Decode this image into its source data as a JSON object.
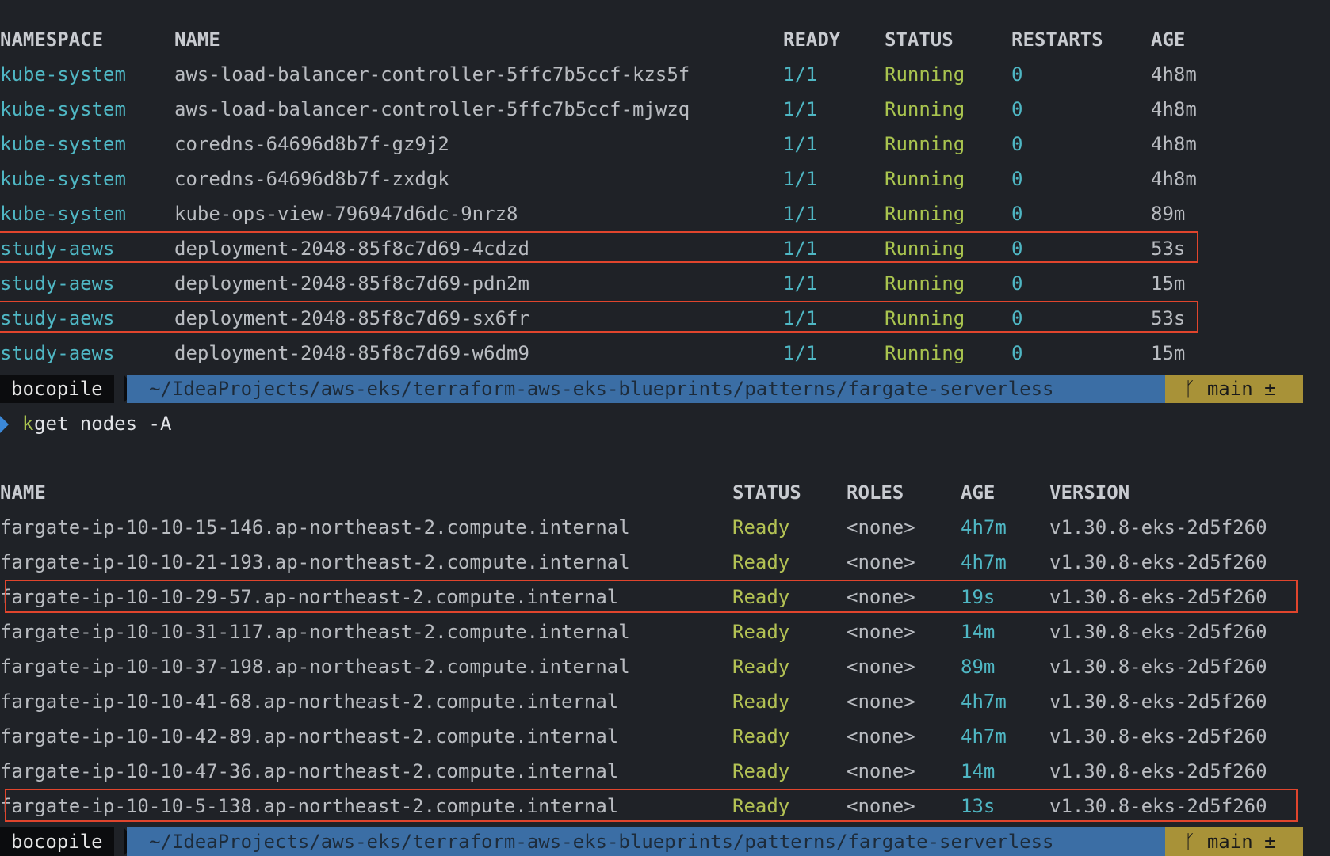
{
  "pods": {
    "headers": {
      "namespace": "NAMESPACE",
      "name": "NAME",
      "ready": "READY",
      "status": "STATUS",
      "restarts": "RESTARTS",
      "age": "AGE"
    },
    "rows": [
      {
        "namespace": "kube-system",
        "name": "aws-load-balancer-controller-5ffc7b5ccf-kzs5f",
        "ready": "1/1",
        "status": "Running",
        "restarts": "0",
        "age": "4h8m",
        "highlighted": false
      },
      {
        "namespace": "kube-system",
        "name": "aws-load-balancer-controller-5ffc7b5ccf-mjwzq",
        "ready": "1/1",
        "status": "Running",
        "restarts": "0",
        "age": "4h8m",
        "highlighted": false
      },
      {
        "namespace": "kube-system",
        "name": "coredns-64696d8b7f-gz9j2",
        "ready": "1/1",
        "status": "Running",
        "restarts": "0",
        "age": "4h8m",
        "highlighted": false
      },
      {
        "namespace": "kube-system",
        "name": "coredns-64696d8b7f-zxdgk",
        "ready": "1/1",
        "status": "Running",
        "restarts": "0",
        "age": "4h8m",
        "highlighted": false
      },
      {
        "namespace": "kube-system",
        "name": "kube-ops-view-796947d6dc-9nrz8",
        "ready": "1/1",
        "status": "Running",
        "restarts": "0",
        "age": "89m",
        "highlighted": false
      },
      {
        "namespace": "study-aews",
        "name": "deployment-2048-85f8c7d69-4cdzd",
        "ready": "1/1",
        "status": "Running",
        "restarts": "0",
        "age": "53s",
        "highlighted": true
      },
      {
        "namespace": "study-aews",
        "name": "deployment-2048-85f8c7d69-pdn2m",
        "ready": "1/1",
        "status": "Running",
        "restarts": "0",
        "age": "15m",
        "highlighted": false
      },
      {
        "namespace": "study-aews",
        "name": "deployment-2048-85f8c7d69-sx6fr",
        "ready": "1/1",
        "status": "Running",
        "restarts": "0",
        "age": "53s",
        "highlighted": true
      },
      {
        "namespace": "study-aews",
        "name": "deployment-2048-85f8c7d69-w6dm9",
        "ready": "1/1",
        "status": "Running",
        "restarts": "0",
        "age": "15m",
        "highlighted": false
      }
    ]
  },
  "prompt": {
    "user": "bocopile",
    "path": "~/IdeaProjects/aws-eks/terraform-aws-eks-blueprints/patterns/fargate-serverless",
    "branch_icon": "git-branch-icon",
    "branch": "main ±"
  },
  "command": {
    "alias": "k",
    "args": " get nodes -A"
  },
  "nodes": {
    "headers": {
      "name": "NAME",
      "status": "STATUS",
      "roles": "ROLES",
      "age": "AGE",
      "version": "VERSION"
    },
    "rows": [
      {
        "name": "fargate-ip-10-10-15-146.ap-northeast-2.compute.internal",
        "status": "Ready",
        "roles": "<none>",
        "age": "4h7m",
        "version": "v1.30.8-eks-2d5f260",
        "highlighted": false
      },
      {
        "name": "fargate-ip-10-10-21-193.ap-northeast-2.compute.internal",
        "status": "Ready",
        "roles": "<none>",
        "age": "4h7m",
        "version": "v1.30.8-eks-2d5f260",
        "highlighted": false
      },
      {
        "name": "fargate-ip-10-10-29-57.ap-northeast-2.compute.internal",
        "status": "Ready",
        "roles": "<none>",
        "age": "19s",
        "version": "v1.30.8-eks-2d5f260",
        "highlighted": true
      },
      {
        "name": "fargate-ip-10-10-31-117.ap-northeast-2.compute.internal",
        "status": "Ready",
        "roles": "<none>",
        "age": "14m",
        "version": "v1.30.8-eks-2d5f260",
        "highlighted": false
      },
      {
        "name": "fargate-ip-10-10-37-198.ap-northeast-2.compute.internal",
        "status": "Ready",
        "roles": "<none>",
        "age": "89m",
        "version": "v1.30.8-eks-2d5f260",
        "highlighted": false
      },
      {
        "name": "fargate-ip-10-10-41-68.ap-northeast-2.compute.internal",
        "status": "Ready",
        "roles": "<none>",
        "age": "4h7m",
        "version": "v1.30.8-eks-2d5f260",
        "highlighted": false
      },
      {
        "name": "fargate-ip-10-10-42-89.ap-northeast-2.compute.internal",
        "status": "Ready",
        "roles": "<none>",
        "age": "4h7m",
        "version": "v1.30.8-eks-2d5f260",
        "highlighted": false
      },
      {
        "name": "fargate-ip-10-10-47-36.ap-northeast-2.compute.internal",
        "status": "Ready",
        "roles": "<none>",
        "age": "14m",
        "version": "v1.30.8-eks-2d5f260",
        "highlighted": false
      },
      {
        "name": "fargate-ip-10-10-5-138.ap-northeast-2.compute.internal",
        "status": "Ready",
        "roles": "<none>",
        "age": "13s",
        "version": "v1.30.8-eks-2d5f260",
        "highlighted": true
      }
    ]
  },
  "colors": {
    "highlight_box": "#e0452d",
    "running": "#a9c44f",
    "teal": "#4fb7c4",
    "path_bg": "#3b6ea5",
    "git_bg": "#a89238"
  }
}
